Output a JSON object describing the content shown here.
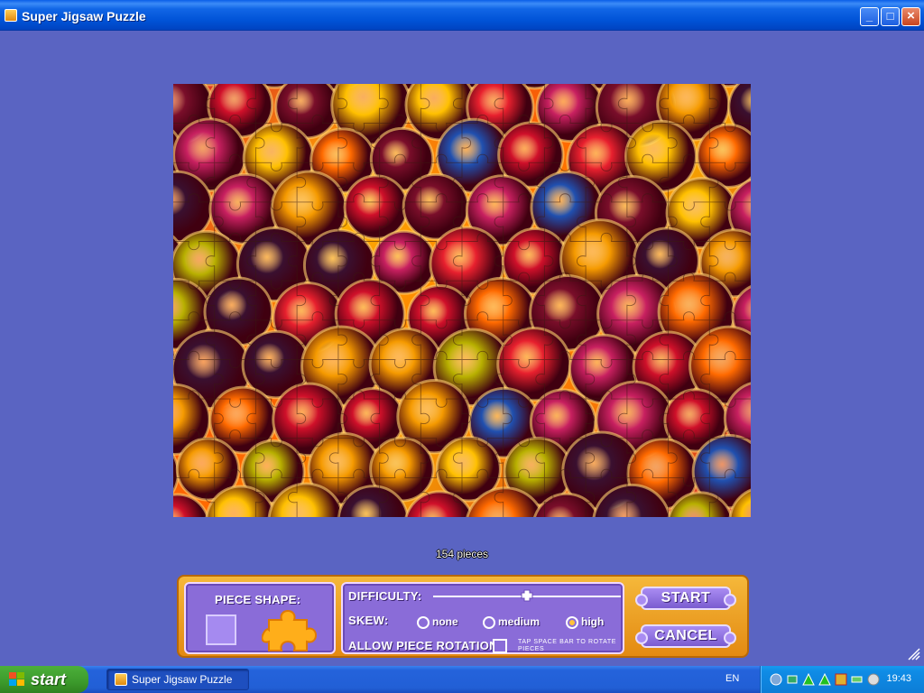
{
  "window": {
    "title": "Super Jigsaw Puzzle",
    "minimize_label": "_",
    "maximize_label": "□",
    "close_label": "×"
  },
  "puzzle": {
    "piece_count_label": "154 pieces",
    "columns": 14,
    "rows": 11
  },
  "panel": {
    "piece_shape_label": "PIECE SHAPE:",
    "difficulty_label": "DIFFICULTY:",
    "difficulty_level": 0.5,
    "skew_label": "SKEW:",
    "skew_options": [
      "none",
      "medium",
      "high"
    ],
    "skew_selected": "high",
    "rotation_label": "ALLOW PIECE ROTATION",
    "rotation_checked": false,
    "rotation_hint": "TAP SPACE BAR TO ROTATE PIECES",
    "start_label": "START",
    "cancel_label": "CANCEL"
  },
  "taskbar": {
    "start_label": "start",
    "task_item_label": "Super Jigsaw Puzzle",
    "language": "EN",
    "clock": "19:43",
    "tray_icons": [
      "shield-icon",
      "network-icon",
      "green-triangle-icon",
      "green-triangle-icon",
      "flag-icon",
      "battery-icon",
      "globe-icon"
    ]
  },
  "colors": {
    "background": "#5a64c2",
    "panel_orange": "#f0a428",
    "panel_purple": "#8a6cd8"
  }
}
